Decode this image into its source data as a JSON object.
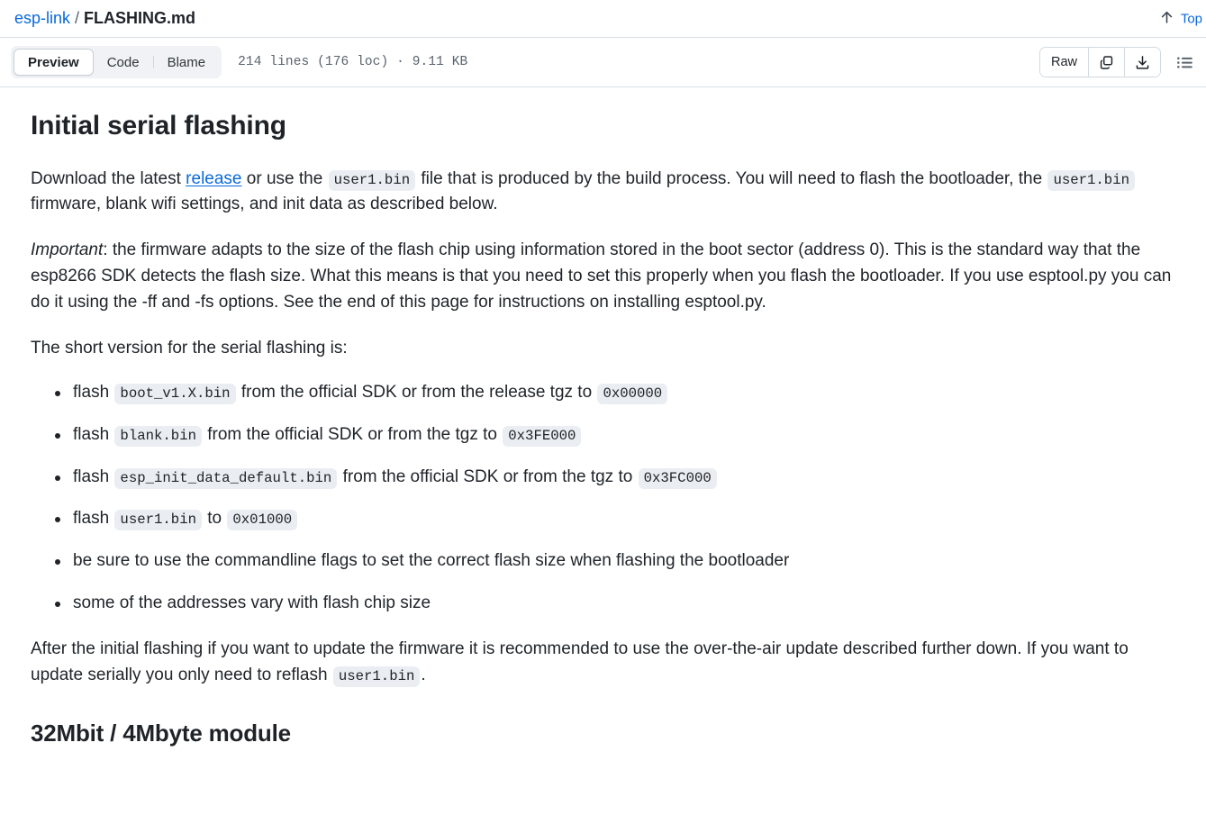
{
  "breadcrumb": {
    "repo": "esp-link",
    "separator": "/",
    "filename": "FLASHING.md"
  },
  "top_link": {
    "label": "Top",
    "icon": "arrow-up-icon"
  },
  "toolbar": {
    "tabs": [
      {
        "label": "Preview",
        "active": true
      },
      {
        "label": "Code",
        "active": false
      },
      {
        "label": "Blame",
        "active": false
      }
    ],
    "file_meta": "214 lines (176 loc) · 9.11 KB",
    "raw_label": "Raw",
    "copy_icon": "copy-icon",
    "download_icon": "download-icon",
    "outline_icon": "outline-list-icon"
  },
  "document": {
    "h1": "Initial serial flashing",
    "p1": {
      "part1": "Download the latest ",
      "link": "release",
      "part2": " or use the ",
      "code1": "user1.bin",
      "part3": " file that is produced by the build process. You will need to flash the bootloader, the ",
      "code2": "user1.bin",
      "part4": " firmware, blank wifi settings, and init data as described below."
    },
    "p2": {
      "em": "Important",
      "text": ": the firmware adapts to the size of the flash chip using information stored in the boot sector (address 0). This is the standard way that the esp8266 SDK detects the flash size. What this means is that you need to set this properly when you flash the bootloader. If you use esptool.py you can do it using the -ff and -fs options. See the end of this page for instructions on installing esptool.py."
    },
    "p3": "The short version for the serial flashing is:",
    "list": [
      {
        "pre": "flash ",
        "code1": "boot_v1.X.bin",
        "mid": " from the official SDK or from the release tgz to ",
        "code2": "0x00000",
        "post": ""
      },
      {
        "pre": "flash ",
        "code1": "blank.bin",
        "mid": " from the official SDK or from the tgz to ",
        "code2": "0x3FE000",
        "post": ""
      },
      {
        "pre": "flash ",
        "code1": "esp_init_data_default.bin",
        "mid": " from the official SDK or from the tgz to ",
        "code2": "0x3FC000",
        "post": ""
      },
      {
        "pre": "flash ",
        "code1": "user1.bin",
        "mid": " to ",
        "code2": "0x01000",
        "post": ""
      },
      {
        "pre": "be sure to use the commandline flags to set the correct flash size when flashing the bootloader",
        "code1": "",
        "mid": "",
        "code2": "",
        "post": ""
      },
      {
        "pre": "some of the addresses vary with flash chip size",
        "code1": "",
        "mid": "",
        "code2": "",
        "post": ""
      }
    ],
    "p4": {
      "part1": "After the initial flashing if you want to update the firmware it is recommended to use the over-the-air update described further down. If you want to update serially you only need to reflash ",
      "code1": "user1.bin",
      "part2": "."
    },
    "h2": "32Mbit / 4Mbyte module"
  },
  "colors": {
    "link": "#0969da",
    "text": "#1f2328",
    "muted": "#59636e",
    "code_bg": "#eaeef2",
    "border": "#d8dee4",
    "seg_bg": "#f0f2f5"
  }
}
